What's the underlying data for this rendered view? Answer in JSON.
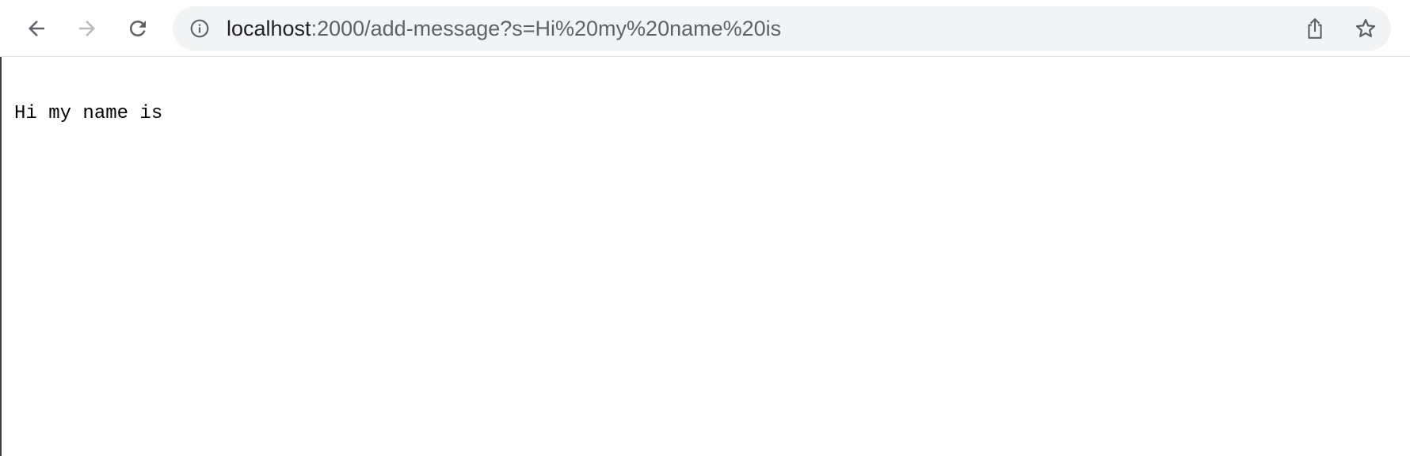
{
  "browser": {
    "address_bar": {
      "host": "localhost",
      "path": ":2000/add-message?s=Hi%20my%20name%20is"
    },
    "icons": {
      "back": "back-arrow-icon",
      "forward": "forward-arrow-icon",
      "reload": "reload-icon",
      "site_info": "info-icon",
      "share": "share-icon",
      "bookmark": "star-icon"
    }
  },
  "page": {
    "message": "Hi my name is"
  }
}
